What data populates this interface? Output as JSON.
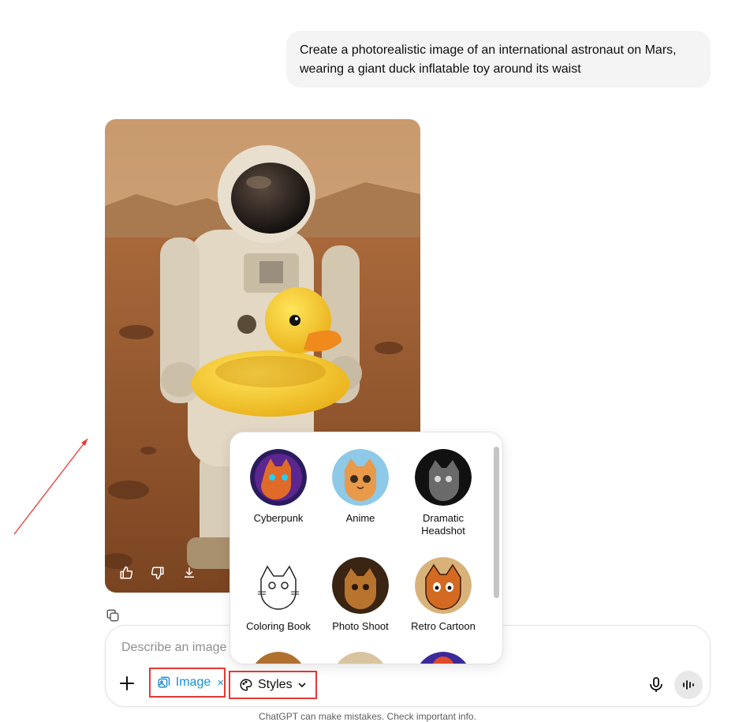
{
  "conversation": {
    "user_message": "Create a photorealistic image of an international astronaut on Mars, wearing a giant duck inflatable toy around its waist"
  },
  "generated_image": {
    "icons": {
      "like": "thumbs-up-icon",
      "dislike": "thumbs-down-icon",
      "download": "download-icon",
      "copy": "copy-icon"
    }
  },
  "styles_menu": {
    "items": [
      {
        "label": "Cyberpunk",
        "color": "#5b2a86"
      },
      {
        "label": "Anime",
        "color": "#e8994a"
      },
      {
        "label": "Dramatic\nHeadshot",
        "color": "#2a2a2a"
      },
      {
        "label": "Coloring Book",
        "color": "#ffffff"
      },
      {
        "label": "Photo Shoot",
        "color": "#7a4a1e"
      },
      {
        "label": "Retro Cartoon",
        "color": "#d97a2a"
      }
    ]
  },
  "composer": {
    "placeholder": "Describe an image",
    "image_chip_label": "Image",
    "image_chip_close": "×",
    "styles_label": "Styles"
  },
  "footer": {
    "note": "ChatGPT can make mistakes. Check important info."
  },
  "colors": {
    "accent_blue": "#1a8fd6",
    "highlight_red": "#e53935"
  }
}
